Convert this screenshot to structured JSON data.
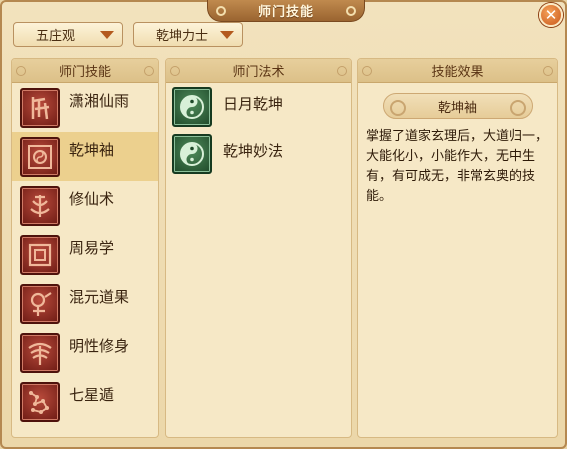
{
  "window": {
    "title": "师门技能"
  },
  "dropdowns": {
    "sect": "五庄观",
    "faction": "乾坤力士"
  },
  "panels": {
    "skills_header": "师门技能",
    "spells_header": "师门法术",
    "effect_header": "技能效果"
  },
  "skills": [
    {
      "label": "潇湘仙雨",
      "icon": "rune-icon"
    },
    {
      "label": "乾坤袖",
      "icon": "sleeve-icon"
    },
    {
      "label": "修仙术",
      "icon": "lotus-icon"
    },
    {
      "label": "周易学",
      "icon": "square-seal-icon"
    },
    {
      "label": "混元道果",
      "icon": "fruit-icon"
    },
    {
      "label": "明性修身",
      "icon": "tree-icon"
    },
    {
      "label": "七星遁",
      "icon": "constellation-icon"
    }
  ],
  "selected_skill_index": 1,
  "spells": [
    {
      "label": "日月乾坤",
      "icon": "yin-yang-icon"
    },
    {
      "label": "乾坤妙法",
      "icon": "yin-yang-icon"
    }
  ],
  "effect": {
    "title": "乾坤袖",
    "description": "掌握了道家玄理后，大道归一，大能化小，小能作大，无中生有，有可成无，非常玄奥的技能。"
  },
  "colors": {
    "accent": "#b45a1e",
    "panel_bg": "#f6e8c6",
    "selected_row": "#ecd08e"
  }
}
